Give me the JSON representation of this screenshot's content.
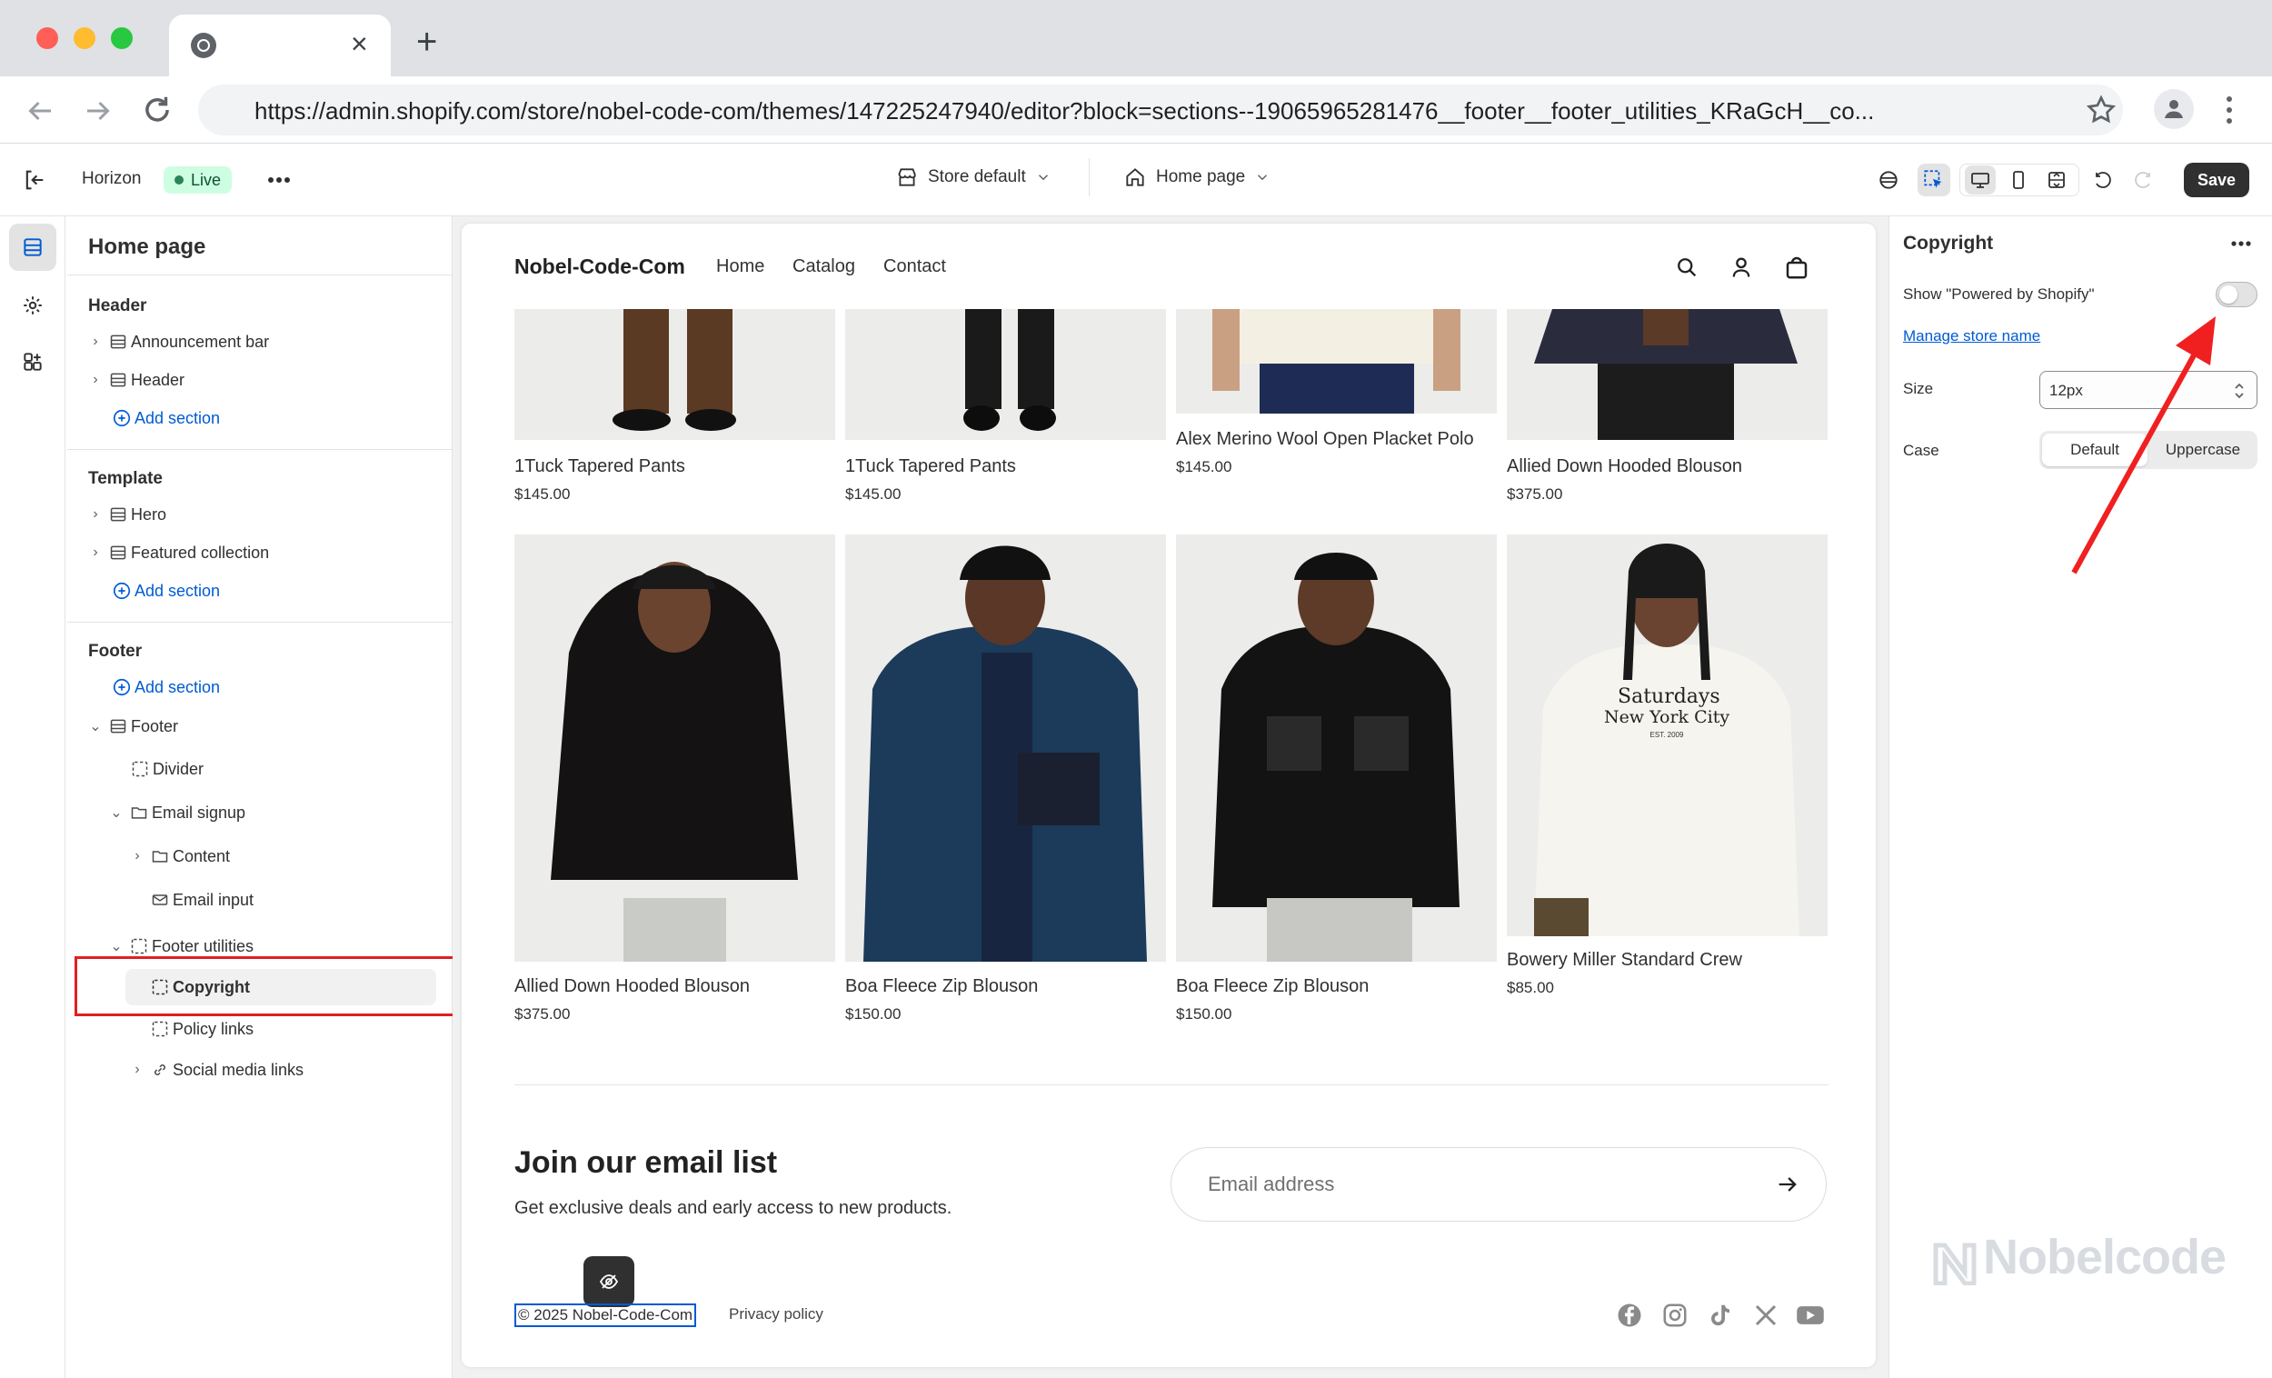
{
  "browser": {
    "url": "https://admin.shopify.com/store/nobel-code-com/themes/147225247940/editor?block=sections--19065965281476__footer__footer_utilities_KRaGcH__co...",
    "new_tab": "+",
    "tab_close": "×"
  },
  "toolbar": {
    "theme_name": "Horizon",
    "live_badge": "Live",
    "store_selector": "Store default",
    "page_selector": "Home page",
    "save_label": "Save"
  },
  "sidebar": {
    "title": "Home page",
    "groups": {
      "header": {
        "label": "Header",
        "items": [
          "Announcement bar",
          "Header"
        ],
        "add": "Add section"
      },
      "template": {
        "label": "Template",
        "items": [
          "Hero",
          "Featured collection"
        ],
        "add": "Add section"
      },
      "footer": {
        "label": "Footer",
        "add": "Add section",
        "footer_item": "Footer",
        "divider": "Divider",
        "email_signup": "Email signup",
        "content": "Content",
        "email_input": "Email input",
        "footer_utilities": "Footer utilities",
        "copyright": "Copyright",
        "policy_links": "Policy links",
        "social_media_links": "Social media links"
      }
    }
  },
  "preview": {
    "store_name": "Nobel-Code-Com",
    "nav": [
      "Home",
      "Catalog",
      "Contact"
    ],
    "products_row1": [
      {
        "name": "1Tuck Tapered Pants",
        "price": "$145.00"
      },
      {
        "name": "1Tuck Tapered Pants",
        "price": "$145.00"
      },
      {
        "name": "Alex Merino Wool Open Placket Polo",
        "price": "$145.00"
      },
      {
        "name": "Allied Down Hooded Blouson",
        "price": "$375.00"
      }
    ],
    "products_row2": [
      {
        "name": "Allied Down Hooded Blouson",
        "price": "$375.00"
      },
      {
        "name": "Boa Fleece Zip Blouson",
        "price": "$150.00"
      },
      {
        "name": "Boa Fleece Zip Blouson",
        "price": "$150.00"
      },
      {
        "name": "Bowery Miller Standard Crew",
        "price": "$85.00"
      }
    ],
    "sweater_print_line1": "Saturdays",
    "sweater_print_line2": "New York City",
    "sweater_print_line3": "EST. 2009",
    "email_heading": "Join our email list",
    "email_sub": "Get exclusive deals and early access to new products.",
    "email_placeholder": "Email address",
    "copyright": "© 2025 Nobel-Code-Com",
    "privacy": "Privacy policy"
  },
  "settings": {
    "title": "Copyright",
    "powered_label": "Show \"Powered by Shopify\"",
    "powered_enabled": false,
    "manage_link": "Manage store name",
    "size_label": "Size",
    "size_value": "12px",
    "case_label": "Case",
    "case_options": [
      "Default",
      "Uppercase"
    ],
    "case_selected": "Default"
  },
  "watermark": "Nobelcode",
  "colors": {
    "accent_link": "#005bd3",
    "live_bg": "#cdfee1",
    "annotation_red": "#e02020",
    "save_bg": "#303030"
  }
}
